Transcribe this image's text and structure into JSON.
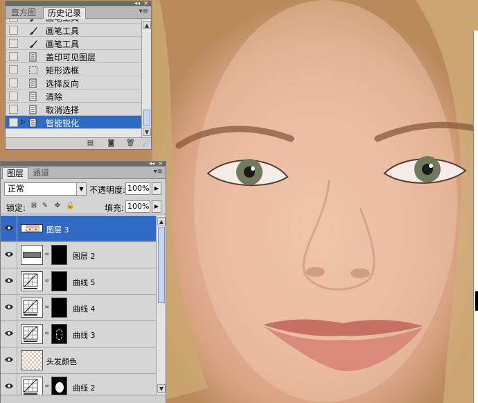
{
  "history_panel": {
    "tabs": [
      {
        "label": "直方图",
        "active": false
      },
      {
        "label": "历史记录",
        "active": true
      }
    ],
    "items": [
      {
        "label": "画笔工具",
        "icon": "brush-icon",
        "selected": false
      },
      {
        "label": "画笔工具",
        "icon": "brush-icon",
        "selected": false
      },
      {
        "label": "画笔工具",
        "icon": "brush-icon",
        "selected": false
      },
      {
        "label": "盖印可见图层",
        "icon": "document-icon",
        "selected": false
      },
      {
        "label": "矩形选框",
        "icon": "marquee-icon",
        "selected": false
      },
      {
        "label": "选择反向",
        "icon": "document-icon",
        "selected": false
      },
      {
        "label": "清除",
        "icon": "document-icon",
        "selected": false
      },
      {
        "label": "取消选择",
        "icon": "document-icon",
        "selected": false
      },
      {
        "label": "智能锐化",
        "icon": "document-icon",
        "selected": true
      }
    ]
  },
  "layers_panel": {
    "tabs": [
      {
        "label": "图层",
        "active": true
      },
      {
        "label": "通道",
        "active": false
      }
    ],
    "blend_mode": "正常",
    "opacity_label": "不透明度:",
    "opacity_value": "100%",
    "lock_label": "锁定:",
    "fill_label": "填充:",
    "fill_value": "100%",
    "layers": [
      {
        "label": "图层 3",
        "type": "image",
        "selected": true
      },
      {
        "label": "图层 2",
        "type": "gray-with-mask",
        "selected": false
      },
      {
        "label": "曲线 5",
        "type": "curves",
        "selected": false
      },
      {
        "label": "曲线 4",
        "type": "curves",
        "selected": false
      },
      {
        "label": "曲线 3",
        "type": "curves",
        "selected": false
      },
      {
        "label": "头发颜色",
        "type": "transparent",
        "selected": false
      },
      {
        "label": "曲线 2",
        "type": "curves",
        "selected": false
      }
    ]
  },
  "colors": {
    "selection": "#2f6bc6",
    "panel_bg": "#d4d4d4"
  }
}
